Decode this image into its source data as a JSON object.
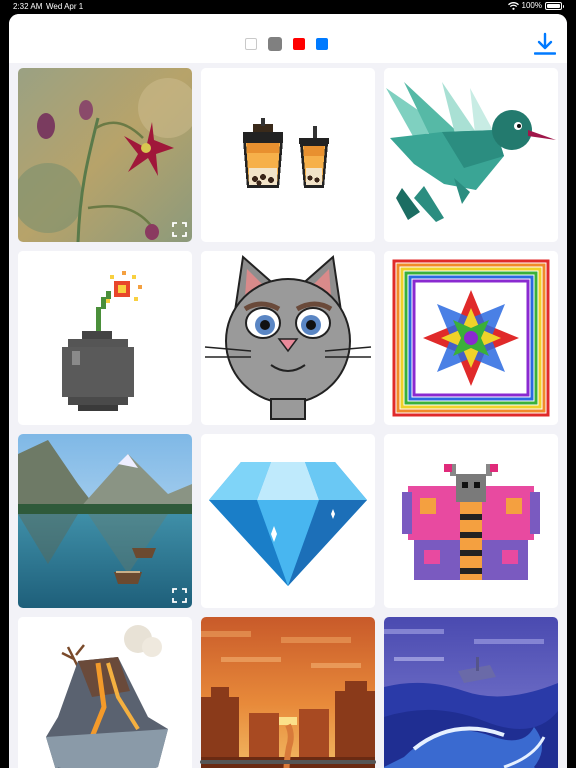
{
  "status_bar": {
    "time": "2:32 AM",
    "date": "Wed Apr 1",
    "battery": "100%",
    "battery_level": 1.0
  },
  "toolbar": {
    "filters": [
      {
        "name": "white",
        "color": "#ffffff"
      },
      {
        "name": "gray",
        "color": "#808080",
        "selected": true
      },
      {
        "name": "red",
        "color": "#ff0000"
      },
      {
        "name": "blue",
        "color": "#007aff"
      }
    ],
    "download_icon": "download-icon",
    "accent": "#007aff"
  },
  "gallery": {
    "items": [
      {
        "subject": "columbine flower painting",
        "expandable": true
      },
      {
        "subject": "bubble tea cups"
      },
      {
        "subject": "hummingbird"
      },
      {
        "subject": "pixel bomb"
      },
      {
        "subject": "gray cat"
      },
      {
        "subject": "geometric rainbow star"
      },
      {
        "subject": "mountain lake with boats",
        "expandable": true
      },
      {
        "subject": "blue diamond"
      },
      {
        "subject": "pink butterfly"
      },
      {
        "subject": "volcano island"
      },
      {
        "subject": "canyon sunset"
      },
      {
        "subject": "ocean wave with ship"
      }
    ]
  }
}
